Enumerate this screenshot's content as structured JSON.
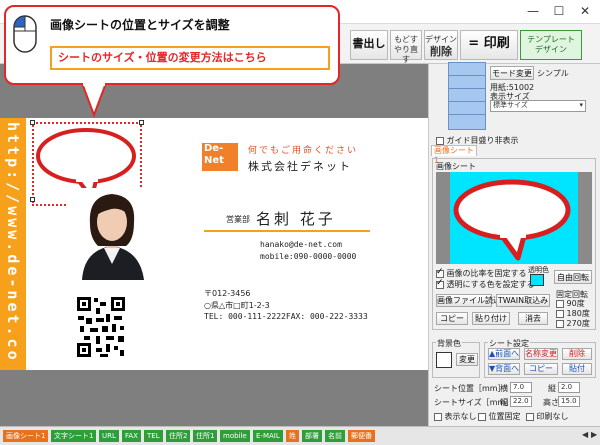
{
  "window": {
    "minimize": "—",
    "maximize": "☐",
    "close": "✕"
  },
  "toolbar": {
    "print_out": "書出し",
    "undo_line1": "もどす",
    "undo_line2": "やり直す",
    "design_line1": "デザイン",
    "design_line2": "削除",
    "equals": "=",
    "print": "印刷",
    "template_line1": "テンプレート",
    "template_line2": "デザイン"
  },
  "callout": {
    "title": "画像シートの位置とサイズを調整",
    "link": "シートのサイズ・位置の変更方法はこちら"
  },
  "card": {
    "url_vertical": "http://www.de-net.co",
    "logo_line1": "De-",
    "logo_line2": "Net",
    "tagline": "何でもご用命ください",
    "company": "株式会社デネット",
    "dept": "営業部",
    "name": "名刺 花子",
    "email": "hanako@de-net.com",
    "mobile": "mobile:090-0000-0000",
    "postal": "〒012-3456",
    "address": "○県△市□町1-2-3",
    "tel_fax": "TEL: 000-111-2222FAX: 000-222-3333"
  },
  "panel": {
    "mode_change": "モード変更",
    "simple": "シンプル",
    "paper_label": "用紙:51002",
    "display_size_label": "表示サイズ",
    "display_size_value": "標準サイズ",
    "guide_print": "ガイド目盛り非表示",
    "image_sheet_tab": "画像シート1",
    "image_sheet_group": "画像シート",
    "keep_ratio": "画像の比率を固定する",
    "transparent": "透明にする色を設定する",
    "transparent_color_label": "透明色",
    "free_rotate": "自由回転",
    "fixed_rotate": "固定回転",
    "rot_90": "90度",
    "rot_180": "180度",
    "rot_270": "270度",
    "load_file": "画像ファイル読込",
    "twain": "TWAIN取込み",
    "copy": "コピー",
    "paste": "貼り付け",
    "erase": "消去",
    "background_color": "背景色",
    "change": "変更",
    "sheet_settings": "シート設定",
    "bring_front": "▲前面へ",
    "rename": "名称変更",
    "delete": "削除",
    "send_back": "▼背面へ",
    "copy2": "コピー",
    "paste2": "貼付",
    "sheet_position_label": "シート位置［mm］",
    "pos_x_label": "横",
    "pos_x": "7.0",
    "pos_y_label": "縦",
    "pos_y": "2.0",
    "sheet_size_label": "シートサイズ［mm］",
    "width_label": "幅",
    "width": "22.0",
    "height_label": "高さ",
    "height": "15.0",
    "hide": "表示なし",
    "lock_position": "位置固定",
    "no_print": "印刷なし"
  },
  "tabs": [
    {
      "label": "画像シート1",
      "color": "#e8721c"
    },
    {
      "label": "文字シート1",
      "color": "#2f9e3a"
    },
    {
      "label": "URL",
      "color": "#2f9e3a"
    },
    {
      "label": "FAX",
      "color": "#2f9e3a"
    },
    {
      "label": "TEL",
      "color": "#2f9e3a"
    },
    {
      "label": "住所2",
      "color": "#2f9e3a"
    },
    {
      "label": "住所1",
      "color": "#2f9e3a"
    },
    {
      "label": "mobile",
      "color": "#2f9e3a"
    },
    {
      "label": "E-MAIL",
      "color": "#2f9e3a"
    },
    {
      "label": "姓",
      "color": "#e8721c"
    },
    {
      "label": "部署",
      "color": "#2f9e3a"
    },
    {
      "label": "名前",
      "color": "#2f9e3a"
    },
    {
      "label": "郵便番",
      "color": "#e8721c"
    }
  ],
  "colors": {
    "accent_red": "#e32626",
    "band_orange": "#f7a01c",
    "cyan_preview": "#00e5ff"
  }
}
